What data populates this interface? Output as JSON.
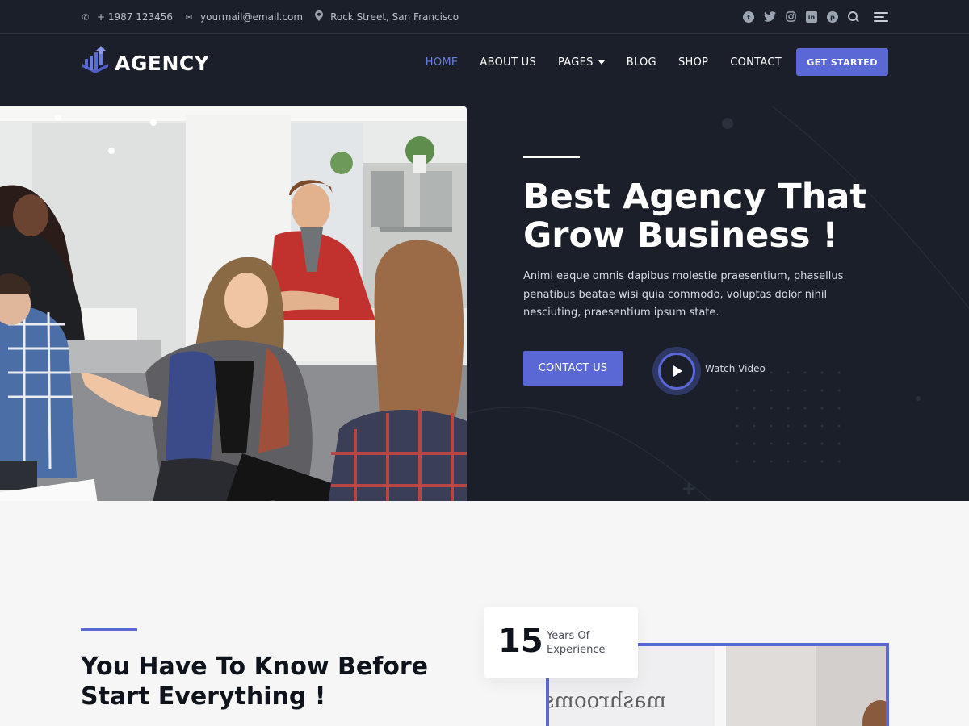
{
  "topbar": {
    "phone": "+ 1987 123456",
    "email": "yourmail@email.com",
    "address": "Rock Street, San Francisco",
    "social_icons": [
      "facebook-icon",
      "twitter-icon",
      "instagram-icon",
      "linkedin-icon",
      "pinterest-icon",
      "search-icon",
      "menu-icon"
    ]
  },
  "header": {
    "logo_text": "AGENCY",
    "nav": [
      {
        "label": "HOME",
        "active": true
      },
      {
        "label": "ABOUT US"
      },
      {
        "label": "PAGES",
        "dropdown": true
      },
      {
        "label": "BLOG"
      },
      {
        "label": "SHOP"
      },
      {
        "label": "CONTACT"
      }
    ],
    "cta": "GET STARTED"
  },
  "hero": {
    "title_line1": "Best Agency That",
    "title_line2": "Grow Business !",
    "text": "Animi eaque omnis dapibus molestie praesentium, phasellus penatibus beatae wisi quia commodo, voluptas dolor nihil nesciuting, praesentium ipsum state.",
    "contact_button": "CONTACT US",
    "watch_label": "Watch Video"
  },
  "about": {
    "title_line1": "You Have To Know Before",
    "title_line2": "Start Everything !",
    "experience_number": "15",
    "experience_label_line1": "Years Of",
    "experience_label_line2": "Experience",
    "sign_text": "mashrooms"
  },
  "colors": {
    "dark": "#1a1f29",
    "accent": "#5a68d6",
    "light_bg": "#f6f6f6"
  }
}
